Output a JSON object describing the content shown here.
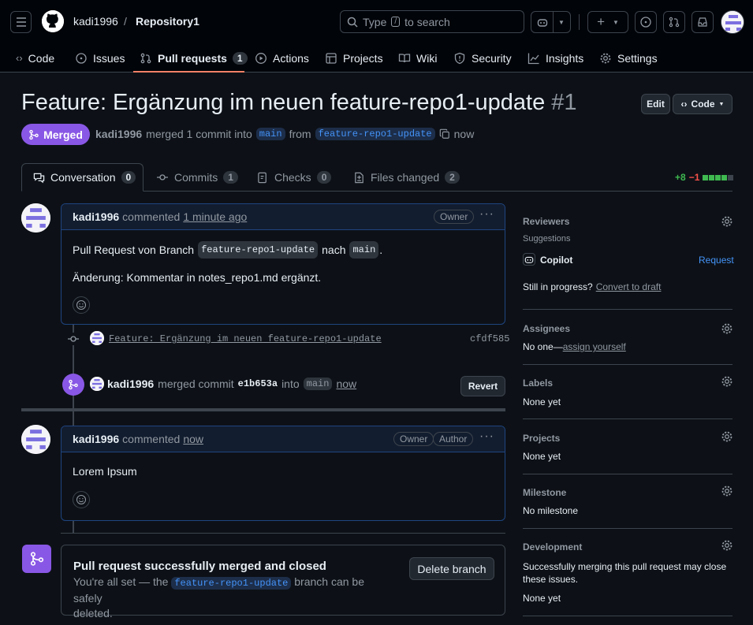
{
  "header": {
    "owner": "kadi1996",
    "separator": "/",
    "repo": "Repository1",
    "search_placeholder": "Type / to search",
    "search_pre": "Type",
    "search_key": "/",
    "search_post": "to search"
  },
  "tabs": [
    {
      "label": "Code"
    },
    {
      "label": "Issues"
    },
    {
      "label": "Pull requests",
      "count": "1"
    },
    {
      "label": "Actions"
    },
    {
      "label": "Projects"
    },
    {
      "label": "Wiki"
    },
    {
      "label": "Security"
    },
    {
      "label": "Insights"
    },
    {
      "label": "Settings"
    }
  ],
  "pr": {
    "title": "Feature: Ergänzung im neuen feature-repo1-update",
    "number": "#1",
    "state": "Merged",
    "author": "kadi1996",
    "merged_text": "merged 1 commit into",
    "base": "main",
    "from": "from",
    "head": "feature-repo1-update",
    "time": "now",
    "edit": "Edit",
    "code_btn": "Code"
  },
  "prtabs": [
    {
      "label": "Conversation",
      "count": "0"
    },
    {
      "label": "Commits",
      "count": "1"
    },
    {
      "label": "Checks",
      "count": "0"
    },
    {
      "label": "Files changed",
      "count": "2"
    }
  ],
  "diffstat": {
    "add": "+8",
    "del": "−1"
  },
  "comment1": {
    "author": "kadi1996",
    "action": "commented",
    "time": "1 minute ago",
    "badge": "Owner",
    "line1_pre": "Pull Request von Branch",
    "line1_code1": "feature-repo1-update",
    "line1_mid": "nach",
    "line1_code2": "main",
    "line1_post": ".",
    "line2": "Änderung: Kommentar in notes_repo1.md ergänzt."
  },
  "commit": {
    "message": "Feature: Ergänzung im neuen feature-repo1-update",
    "sha": "cfdf585"
  },
  "mergeevent": {
    "author": "kadi1996",
    "text": "merged commit",
    "sha": "e1b653a",
    "into": "into",
    "branch": "main",
    "time": "now",
    "revert": "Revert"
  },
  "comment2": {
    "author": "kadi1996",
    "action": "commented",
    "time": "now",
    "badge1": "Owner",
    "badge2": "Author",
    "body": "Lorem Ipsum"
  },
  "mergebox": {
    "title": "Pull request successfully merged and closed",
    "pre": "You're all set — the",
    "branch": "feature-repo1-update",
    "post": "branch can be safely",
    "post2": "deleted.",
    "button": "Delete branch"
  },
  "sidebar": {
    "reviewers": "Reviewers",
    "suggestions": "Suggestions",
    "copilot": "Copilot",
    "request": "Request",
    "progress": "Still in progress?",
    "draft": "Convert to draft",
    "assignees": "Assignees",
    "noone": "No one—",
    "assign": "assign yourself",
    "labels": "Labels",
    "labels_val": "None yet",
    "projects": "Projects",
    "projects_val": "None yet",
    "milestone": "Milestone",
    "milestone_val": "No milestone",
    "development": "Development",
    "dev_text1": "Successfully merging this pull request may close",
    "dev_text2": "these issues.",
    "dev_val": "None yet"
  },
  "colors": {
    "merged": "#8957e5",
    "accent": "#4493f8",
    "underline": "#f78166",
    "add": "#3fb950",
    "del": "#f85149"
  }
}
